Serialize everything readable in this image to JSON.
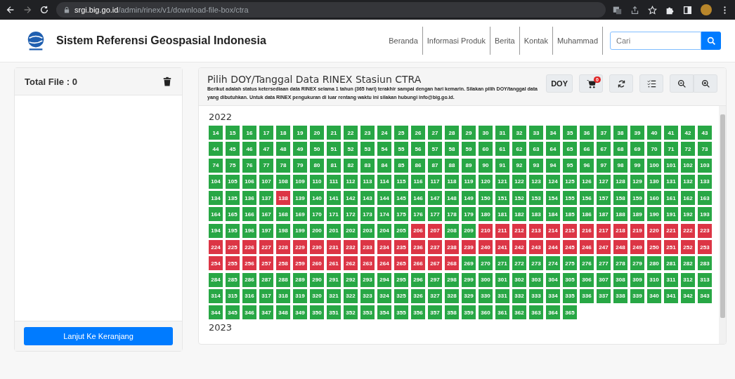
{
  "browser": {
    "url_host": "srgi.big.go.id",
    "url_path": "/admin/rinex/v1/download-file-box/ctra"
  },
  "navbar": {
    "title": "Sistem Referensi Geospasial Indonesia",
    "links": [
      "Beranda",
      "Informasi Produk",
      "Berita",
      "Kontak",
      "Muhammad"
    ],
    "search": {
      "placeholder": "Cari"
    }
  },
  "file_panel": {
    "title": "Total File : 0",
    "button": "Lanjut Ke Keranjang"
  },
  "doy_panel": {
    "title": "Pilih DOY/Tanggal Data RINEX Stasiun CTRA",
    "description": "Berikut adalah status ketersediaan data RINEX selama 1 tahun (365 hari) terakhir sampai dengan hari kemarin. Silakan pilih DOY/tanggal data yang dibutuhkan. Untuk data RINEX pengukuran di luar rentang waktu ini silakan hubungi info@big.go.id.",
    "doy_button": "DOY",
    "cart_count": "0",
    "years": [
      {
        "year": "2022",
        "days": [
          {
            "label": "14",
            "available": true
          },
          {
            "label": "15",
            "available": true
          },
          {
            "label": "16",
            "available": true
          },
          {
            "label": "17",
            "available": true
          },
          {
            "label": "18",
            "available": true
          },
          {
            "label": "19",
            "available": true
          },
          {
            "label": "20",
            "available": true
          },
          {
            "label": "21",
            "available": true
          },
          {
            "label": "22",
            "available": true
          },
          {
            "label": "23",
            "available": true
          },
          {
            "label": "24",
            "available": true
          },
          {
            "label": "25",
            "available": true
          },
          {
            "label": "26",
            "available": true
          },
          {
            "label": "27",
            "available": true
          },
          {
            "label": "28",
            "available": true
          },
          {
            "label": "29",
            "available": true
          },
          {
            "label": "30",
            "available": true
          },
          {
            "label": "31",
            "available": true
          },
          {
            "label": "32",
            "available": true
          },
          {
            "label": "33",
            "available": true
          },
          {
            "label": "34",
            "available": true
          },
          {
            "label": "35",
            "available": true
          },
          {
            "label": "36",
            "available": true
          },
          {
            "label": "37",
            "available": true
          },
          {
            "label": "38",
            "available": true
          },
          {
            "label": "39",
            "available": true
          },
          {
            "label": "40",
            "available": true
          },
          {
            "label": "41",
            "available": true
          },
          {
            "label": "42",
            "available": true
          },
          {
            "label": "43",
            "available": true
          },
          {
            "label": "44",
            "available": true
          },
          {
            "label": "45",
            "available": true
          },
          {
            "label": "46",
            "available": true
          },
          {
            "label": "47",
            "available": true
          },
          {
            "label": "48",
            "available": true
          },
          {
            "label": "49",
            "available": true
          },
          {
            "label": "50",
            "available": true
          },
          {
            "label": "51",
            "available": true
          },
          {
            "label": "52",
            "available": true
          },
          {
            "label": "53",
            "available": true
          },
          {
            "label": "54",
            "available": true
          },
          {
            "label": "55",
            "available": true
          },
          {
            "label": "56",
            "available": true
          },
          {
            "label": "57",
            "available": true
          },
          {
            "label": "58",
            "available": true
          },
          {
            "label": "59",
            "available": true
          },
          {
            "label": "60",
            "available": true
          },
          {
            "label": "61",
            "available": true
          },
          {
            "label": "62",
            "available": true
          },
          {
            "label": "63",
            "available": true
          },
          {
            "label": "64",
            "available": true
          },
          {
            "label": "65",
            "available": true
          },
          {
            "label": "66",
            "available": true
          },
          {
            "label": "67",
            "available": true
          },
          {
            "label": "68",
            "available": true
          },
          {
            "label": "69",
            "available": true
          },
          {
            "label": "70",
            "available": true
          },
          {
            "label": "71",
            "available": true
          },
          {
            "label": "72",
            "available": true
          },
          {
            "label": "73",
            "available": true
          },
          {
            "label": "74",
            "available": true
          },
          {
            "label": "75",
            "available": true
          },
          {
            "label": "76",
            "available": true
          },
          {
            "label": "77",
            "available": true
          },
          {
            "label": "78",
            "available": true
          },
          {
            "label": "79",
            "available": true
          },
          {
            "label": "80",
            "available": true
          },
          {
            "label": "81",
            "available": true
          },
          {
            "label": "82",
            "available": true
          },
          {
            "label": "83",
            "available": true
          },
          {
            "label": "84",
            "available": true
          },
          {
            "label": "85",
            "available": true
          },
          {
            "label": "86",
            "available": true
          },
          {
            "label": "87",
            "available": true
          },
          {
            "label": "88",
            "available": true
          },
          {
            "label": "89",
            "available": true
          },
          {
            "label": "90",
            "available": true
          },
          {
            "label": "91",
            "available": true
          },
          {
            "label": "92",
            "available": true
          },
          {
            "label": "93",
            "available": true
          },
          {
            "label": "94",
            "available": true
          },
          {
            "label": "95",
            "available": true
          },
          {
            "label": "96",
            "available": true
          },
          {
            "label": "97",
            "available": true
          },
          {
            "label": "98",
            "available": true
          },
          {
            "label": "99",
            "available": true
          },
          {
            "label": "100",
            "available": true
          },
          {
            "label": "101",
            "available": true
          },
          {
            "label": "102",
            "available": true
          },
          {
            "label": "103",
            "available": true
          },
          {
            "label": "104",
            "available": true
          },
          {
            "label": "105",
            "available": true
          },
          {
            "label": "106",
            "available": true
          },
          {
            "label": "107",
            "available": true
          },
          {
            "label": "108",
            "available": true
          },
          {
            "label": "109",
            "available": true
          },
          {
            "label": "110",
            "available": true
          },
          {
            "label": "111",
            "available": true
          },
          {
            "label": "112",
            "available": true
          },
          {
            "label": "113",
            "available": true
          },
          {
            "label": "114",
            "available": true
          },
          {
            "label": "115",
            "available": true
          },
          {
            "label": "116",
            "available": true
          },
          {
            "label": "117",
            "available": true
          },
          {
            "label": "118",
            "available": true
          },
          {
            "label": "119",
            "available": true
          },
          {
            "label": "120",
            "available": true
          },
          {
            "label": "121",
            "available": true
          },
          {
            "label": "122",
            "available": true
          },
          {
            "label": "123",
            "available": true
          },
          {
            "label": "124",
            "available": true
          },
          {
            "label": "125",
            "available": true
          },
          {
            "label": "126",
            "available": true
          },
          {
            "label": "127",
            "available": true
          },
          {
            "label": "128",
            "available": true
          },
          {
            "label": "129",
            "available": true
          },
          {
            "label": "130",
            "available": true
          },
          {
            "label": "131",
            "available": true
          },
          {
            "label": "132",
            "available": true
          },
          {
            "label": "133",
            "available": true
          },
          {
            "label": "134",
            "available": true
          },
          {
            "label": "135",
            "available": true
          },
          {
            "label": "136",
            "available": true
          },
          {
            "label": "137",
            "available": true
          },
          {
            "label": "138",
            "available": false
          },
          {
            "label": "139",
            "available": true
          },
          {
            "label": "140",
            "available": true
          },
          {
            "label": "141",
            "available": true
          },
          {
            "label": "142",
            "available": true
          },
          {
            "label": "143",
            "available": true
          },
          {
            "label": "144",
            "available": true
          },
          {
            "label": "145",
            "available": true
          },
          {
            "label": "146",
            "available": true
          },
          {
            "label": "147",
            "available": true
          },
          {
            "label": "148",
            "available": true
          },
          {
            "label": "149",
            "available": true
          },
          {
            "label": "150",
            "available": true
          },
          {
            "label": "151",
            "available": true
          },
          {
            "label": "152",
            "available": true
          },
          {
            "label": "153",
            "available": true
          },
          {
            "label": "154",
            "available": true
          },
          {
            "label": "155",
            "available": true
          },
          {
            "label": "156",
            "available": true
          },
          {
            "label": "157",
            "available": true
          },
          {
            "label": "158",
            "available": true
          },
          {
            "label": "159",
            "available": true
          },
          {
            "label": "160",
            "available": true
          },
          {
            "label": "161",
            "available": true
          },
          {
            "label": "162",
            "available": true
          },
          {
            "label": "163",
            "available": true
          },
          {
            "label": "164",
            "available": true
          },
          {
            "label": "165",
            "available": true
          },
          {
            "label": "166",
            "available": true
          },
          {
            "label": "167",
            "available": true
          },
          {
            "label": "168",
            "available": true
          },
          {
            "label": "169",
            "available": true
          },
          {
            "label": "170",
            "available": true
          },
          {
            "label": "171",
            "available": true
          },
          {
            "label": "172",
            "available": true
          },
          {
            "label": "173",
            "available": true
          },
          {
            "label": "174",
            "available": true
          },
          {
            "label": "175",
            "available": true
          },
          {
            "label": "176",
            "available": true
          },
          {
            "label": "177",
            "available": true
          },
          {
            "label": "178",
            "available": true
          },
          {
            "label": "179",
            "available": true
          },
          {
            "label": "180",
            "available": true
          },
          {
            "label": "181",
            "available": true
          },
          {
            "label": "182",
            "available": true
          },
          {
            "label": "183",
            "available": true
          },
          {
            "label": "184",
            "available": true
          },
          {
            "label": "185",
            "available": true
          },
          {
            "label": "186",
            "available": true
          },
          {
            "label": "187",
            "available": true
          },
          {
            "label": "188",
            "available": true
          },
          {
            "label": "189",
            "available": true
          },
          {
            "label": "190",
            "available": true
          },
          {
            "label": "191",
            "available": true
          },
          {
            "label": "192",
            "available": true
          },
          {
            "label": "193",
            "available": true
          },
          {
            "label": "194",
            "available": true
          },
          {
            "label": "195",
            "available": true
          },
          {
            "label": "196",
            "available": true
          },
          {
            "label": "197",
            "available": true
          },
          {
            "label": "198",
            "available": true
          },
          {
            "label": "199",
            "available": true
          },
          {
            "label": "200",
            "available": true
          },
          {
            "label": "201",
            "available": true
          },
          {
            "label": "202",
            "available": true
          },
          {
            "label": "203",
            "available": true
          },
          {
            "label": "204",
            "available": true
          },
          {
            "label": "205",
            "available": true
          },
          {
            "label": "206",
            "available": false
          },
          {
            "label": "207",
            "available": false
          },
          {
            "label": "208",
            "available": true
          },
          {
            "label": "209",
            "available": true
          },
          {
            "label": "210",
            "available": false
          },
          {
            "label": "211",
            "available": false
          },
          {
            "label": "212",
            "available": false
          },
          {
            "label": "213",
            "available": false
          },
          {
            "label": "214",
            "available": false
          },
          {
            "label": "215",
            "available": false
          },
          {
            "label": "216",
            "available": false
          },
          {
            "label": "217",
            "available": false
          },
          {
            "label": "218",
            "available": false
          },
          {
            "label": "219",
            "available": false
          },
          {
            "label": "220",
            "available": false
          },
          {
            "label": "221",
            "available": false
          },
          {
            "label": "222",
            "available": false
          },
          {
            "label": "223",
            "available": false
          },
          {
            "label": "224",
            "available": false
          },
          {
            "label": "225",
            "available": false
          },
          {
            "label": "226",
            "available": false
          },
          {
            "label": "227",
            "available": false
          },
          {
            "label": "228",
            "available": false
          },
          {
            "label": "229",
            "available": false
          },
          {
            "label": "230",
            "available": false
          },
          {
            "label": "231",
            "available": false
          },
          {
            "label": "232",
            "available": false
          },
          {
            "label": "233",
            "available": false
          },
          {
            "label": "234",
            "available": false
          },
          {
            "label": "235",
            "available": false
          },
          {
            "label": "236",
            "available": false
          },
          {
            "label": "237",
            "available": false
          },
          {
            "label": "238",
            "available": false
          },
          {
            "label": "239",
            "available": false
          },
          {
            "label": "240",
            "available": false
          },
          {
            "label": "241",
            "available": false
          },
          {
            "label": "242",
            "available": false
          },
          {
            "label": "243",
            "available": false
          },
          {
            "label": "244",
            "available": false
          },
          {
            "label": "245",
            "available": false
          },
          {
            "label": "246",
            "available": false
          },
          {
            "label": "247",
            "available": false
          },
          {
            "label": "248",
            "available": false
          },
          {
            "label": "249",
            "available": false
          },
          {
            "label": "250",
            "available": false
          },
          {
            "label": "251",
            "available": false
          },
          {
            "label": "252",
            "available": false
          },
          {
            "label": "253",
            "available": false
          },
          {
            "label": "254",
            "available": false
          },
          {
            "label": "255",
            "available": false
          },
          {
            "label": "256",
            "available": false
          },
          {
            "label": "257",
            "available": false
          },
          {
            "label": "258",
            "available": false
          },
          {
            "label": "259",
            "available": false
          },
          {
            "label": "260",
            "available": false
          },
          {
            "label": "261",
            "available": false
          },
          {
            "label": "262",
            "available": false
          },
          {
            "label": "263",
            "available": false
          },
          {
            "label": "264",
            "available": false
          },
          {
            "label": "265",
            "available": false
          },
          {
            "label": "266",
            "available": false
          },
          {
            "label": "267",
            "available": false
          },
          {
            "label": "268",
            "available": false
          },
          {
            "label": "269",
            "available": true
          },
          {
            "label": "270",
            "available": true
          },
          {
            "label": "271",
            "available": true
          },
          {
            "label": "272",
            "available": true
          },
          {
            "label": "273",
            "available": true
          },
          {
            "label": "274",
            "available": true
          },
          {
            "label": "275",
            "available": true
          },
          {
            "label": "276",
            "available": true
          },
          {
            "label": "277",
            "available": true
          },
          {
            "label": "278",
            "available": true
          },
          {
            "label": "279",
            "available": true
          },
          {
            "label": "280",
            "available": true
          },
          {
            "label": "281",
            "available": true
          },
          {
            "label": "282",
            "available": true
          },
          {
            "label": "283",
            "available": true
          },
          {
            "label": "284",
            "available": true
          },
          {
            "label": "285",
            "available": true
          },
          {
            "label": "286",
            "available": true
          },
          {
            "label": "287",
            "available": true
          },
          {
            "label": "288",
            "available": true
          },
          {
            "label": "289",
            "available": true
          },
          {
            "label": "290",
            "available": true
          },
          {
            "label": "291",
            "available": true
          },
          {
            "label": "292",
            "available": true
          },
          {
            "label": "293",
            "available": true
          },
          {
            "label": "294",
            "available": true
          },
          {
            "label": "295",
            "available": true
          },
          {
            "label": "296",
            "available": true
          },
          {
            "label": "297",
            "available": true
          },
          {
            "label": "298",
            "available": true
          },
          {
            "label": "299",
            "available": true
          },
          {
            "label": "300",
            "available": true
          },
          {
            "label": "301",
            "available": true
          },
          {
            "label": "302",
            "available": true
          },
          {
            "label": "303",
            "available": true
          },
          {
            "label": "304",
            "available": true
          },
          {
            "label": "305",
            "available": true
          },
          {
            "label": "306",
            "available": true
          },
          {
            "label": "307",
            "available": true
          },
          {
            "label": "308",
            "available": true
          },
          {
            "label": "309",
            "available": true
          },
          {
            "label": "310",
            "available": true
          },
          {
            "label": "311",
            "available": true
          },
          {
            "label": "312",
            "available": true
          },
          {
            "label": "313",
            "available": true
          },
          {
            "label": "314",
            "available": true
          },
          {
            "label": "315",
            "available": true
          },
          {
            "label": "316",
            "available": true
          },
          {
            "label": "317",
            "available": true
          },
          {
            "label": "318",
            "available": true
          },
          {
            "label": "319",
            "available": true
          },
          {
            "label": "320",
            "available": true
          },
          {
            "label": "321",
            "available": true
          },
          {
            "label": "322",
            "available": true
          },
          {
            "label": "323",
            "available": true
          },
          {
            "label": "324",
            "available": true
          },
          {
            "label": "325",
            "available": true
          },
          {
            "label": "326",
            "available": true
          },
          {
            "label": "327",
            "available": true
          },
          {
            "label": "328",
            "available": true
          },
          {
            "label": "329",
            "available": true
          },
          {
            "label": "330",
            "available": true
          },
          {
            "label": "331",
            "available": true
          },
          {
            "label": "332",
            "available": true
          },
          {
            "label": "333",
            "available": true
          },
          {
            "label": "334",
            "available": true
          },
          {
            "label": "335",
            "available": true
          },
          {
            "label": "336",
            "available": true
          },
          {
            "label": "337",
            "available": true
          },
          {
            "label": "338",
            "available": true
          },
          {
            "label": "339",
            "available": true
          },
          {
            "label": "340",
            "available": true
          },
          {
            "label": "341",
            "available": true
          },
          {
            "label": "342",
            "available": true
          },
          {
            "label": "343",
            "available": true
          },
          {
            "label": "344",
            "available": true
          },
          {
            "label": "345",
            "available": true
          },
          {
            "label": "346",
            "available": true
          },
          {
            "label": "347",
            "available": true
          },
          {
            "label": "348",
            "available": true
          },
          {
            "label": "349",
            "available": true
          },
          {
            "label": "350",
            "available": true
          },
          {
            "label": "351",
            "available": true
          },
          {
            "label": "352",
            "available": true
          },
          {
            "label": "353",
            "available": true
          },
          {
            "label": "354",
            "available": true
          },
          {
            "label": "355",
            "available": true
          },
          {
            "label": "356",
            "available": true
          },
          {
            "label": "357",
            "available": true
          },
          {
            "label": "358",
            "available": true
          },
          {
            "label": "359",
            "available": true
          },
          {
            "label": "360",
            "available": true
          },
          {
            "label": "361",
            "available": true
          },
          {
            "label": "362",
            "available": true
          },
          {
            "label": "363",
            "available": true
          },
          {
            "label": "364",
            "available": true
          },
          {
            "label": "365",
            "available": true
          }
        ]
      },
      {
        "year": "2023"
      }
    ]
  }
}
